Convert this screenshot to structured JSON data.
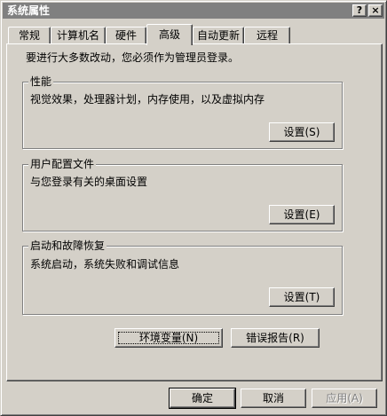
{
  "window": {
    "title": "系统属性"
  },
  "titlebar": {
    "help_label": "?",
    "close_label": "×"
  },
  "tabs": [
    {
      "label": "常规"
    },
    {
      "label": "计算机名"
    },
    {
      "label": "硬件"
    },
    {
      "label": "高级",
      "active": true
    },
    {
      "label": "自动更新"
    },
    {
      "label": "远程"
    }
  ],
  "advanced": {
    "intro": "要进行大多数改动，您必须作为管理员登录。",
    "performance": {
      "title": "性能",
      "description": "视觉效果，处理器计划，内存使用，以及虚拟内存",
      "button": "设置(S)"
    },
    "user_profiles": {
      "title": "用户配置文件",
      "description": "与您登录有关的桌面设置",
      "button": "设置(E)"
    },
    "startup_recovery": {
      "title": "启动和故障恢复",
      "description": "系统启动，系统失败和调试信息",
      "button": "设置(T)"
    },
    "env_vars_button": "环境变量(N)",
    "error_report_button": "错误报告(R)"
  },
  "footer": {
    "ok": "确定",
    "cancel": "取消",
    "apply": "应用(A)"
  }
}
